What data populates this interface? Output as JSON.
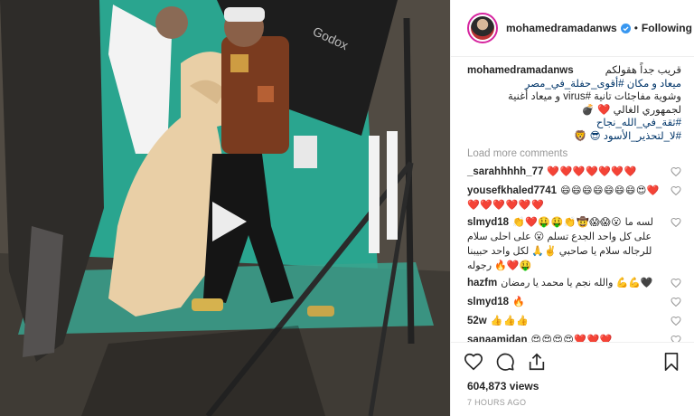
{
  "post": {
    "username": "mohamedramadanws",
    "follow_status": "Following",
    "separator": "•",
    "caption": {
      "username": "mohamedramadanws",
      "lines": [
        "قريب جداً هقولكم",
        "ميعاد و مكان #أقوى_حفلة_في_مصر",
        "وشوية مفاجئات تانية #virus و ميعاد أغنية",
        "لجمهوري الغالي ❤️ 💣",
        "#ثقة_في_الله_نجاح",
        "#لا_لتحذير_الأسود 😎 🦁"
      ]
    },
    "load_more": "Load more comments",
    "comments": [
      {
        "user": "_sarahhhhh_77",
        "text": "❤️❤️❤️❤️❤️❤️❤️",
        "rtl": false
      },
      {
        "user": "yousefkhaled7741",
        "text": "😄😄😄😄😄😄😄😍❤️❤️❤️❤️❤️❤️❤️",
        "rtl": false
      },
      {
        "user": "slmyd18",
        "text": "👏❤️🤑🤑👏🤠😱😱😮 لسه ما على كل واحد الجدع تسلم 😮 على احلى سلام للرجاله سلام يا صاحبي ✌️🙏 لكل واحد حبيبنا رجوله 🔥❤️🤑",
        "rtl": false
      },
      {
        "user": "hazfm",
        "text": "والله نجم يا محمد يا رمضان 💪💪🖤",
        "rtl": false
      },
      {
        "user": "slmyd18",
        "text": "🔥",
        "rtl": false
      },
      {
        "user": "52w",
        "text": "👍👍👍",
        "rtl": false
      },
      {
        "user": "sanaamidan",
        "text": "😍😍😍😍❤️❤️❤️",
        "rtl": false
      }
    ],
    "views": "604,873 views",
    "time_ago": "7 HOURS AGO"
  },
  "colors": {
    "accent": "#003569",
    "muted": "#999999",
    "verified": "#3897f0",
    "green_screen": "#2aa58f"
  },
  "icons": {
    "verified": "verified-badge-icon",
    "play": "play-icon",
    "heart": "heart-outline-icon",
    "comment": "comment-icon",
    "share": "share-icon",
    "save": "bookmark-icon"
  }
}
